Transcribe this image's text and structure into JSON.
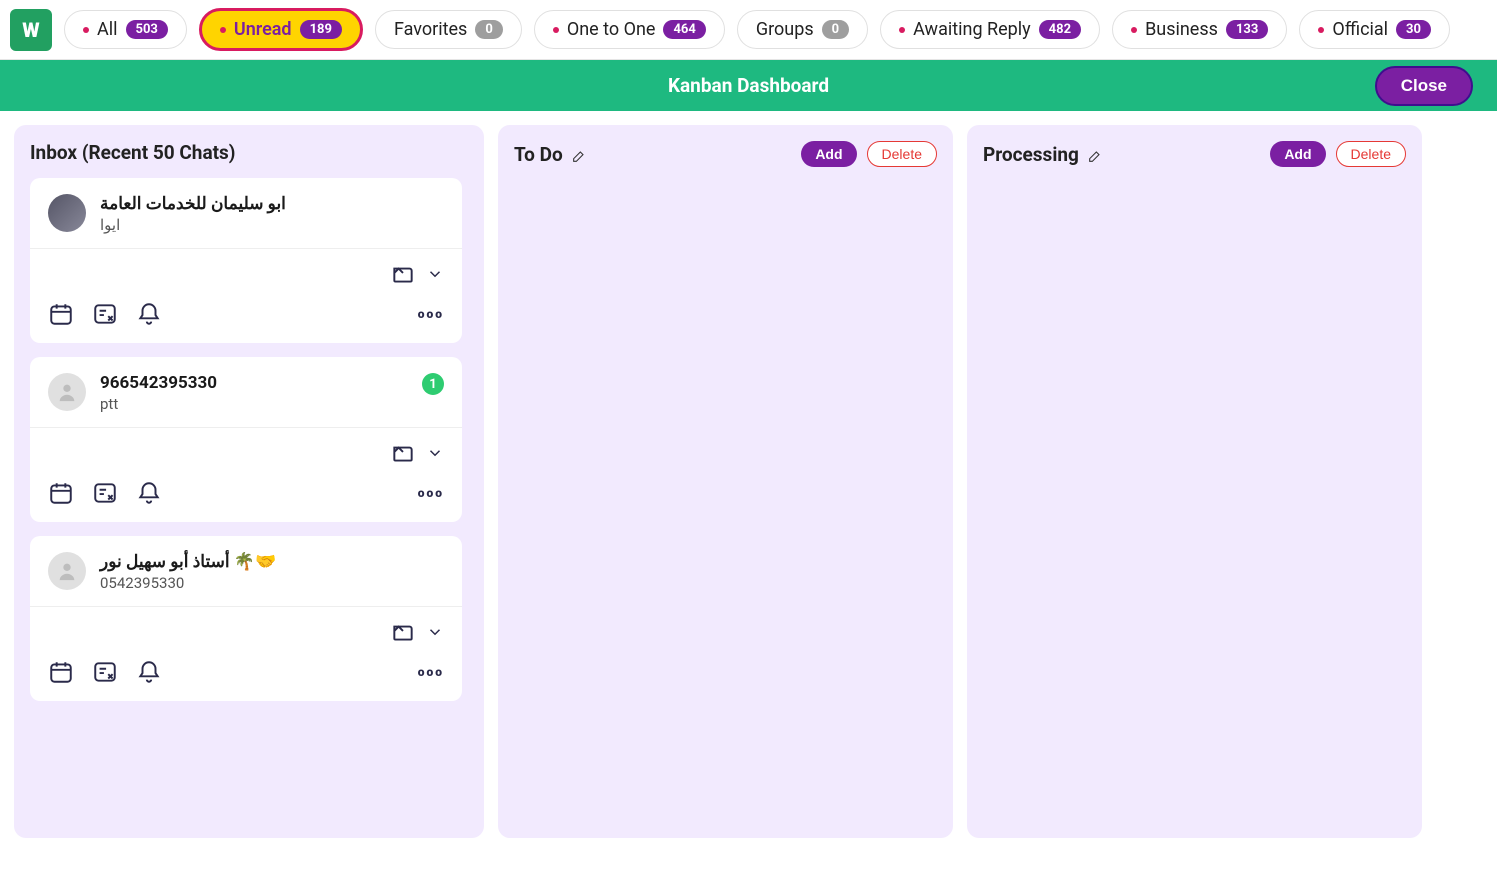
{
  "tabs": [
    {
      "label": "All",
      "count": "503",
      "dot": true
    },
    {
      "label": "Unread",
      "count": "189",
      "dot": true,
      "active": true
    },
    {
      "label": "Favorites",
      "count": "0",
      "dot": false,
      "gray": true
    },
    {
      "label": "One to One",
      "count": "464",
      "dot": true
    },
    {
      "label": "Groups",
      "count": "0",
      "dot": false,
      "gray": true
    },
    {
      "label": "Awaiting Reply",
      "count": "482",
      "dot": true
    },
    {
      "label": "Business",
      "count": "133",
      "dot": true
    },
    {
      "label": "Official",
      "count": "30",
      "dot": true
    }
  ],
  "titlebar": {
    "title": "Kanban Dashboard",
    "close": "Close"
  },
  "inbox": {
    "title": "Inbox (Recent 50 Chats)",
    "chats": [
      {
        "name": "ابو سليمان للخدمات العامة",
        "msg": "ايوا",
        "avatar": "img"
      },
      {
        "name": "966542395330",
        "msg": "ptt",
        "unread": "1"
      },
      {
        "name": "أستاذ أبو سهيل نور 🌴🤝",
        "msg": "0542395330"
      }
    ]
  },
  "columns": [
    {
      "title": "To Do",
      "add": "Add",
      "del": "Delete"
    },
    {
      "title": "Processing",
      "add": "Add",
      "del": "Delete"
    }
  ]
}
